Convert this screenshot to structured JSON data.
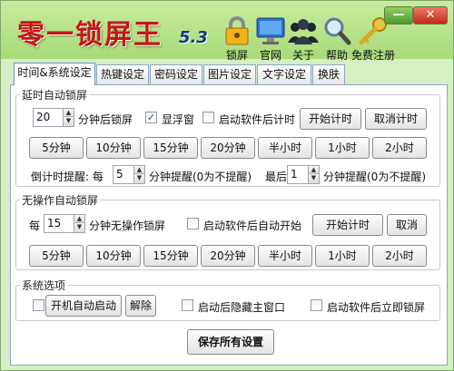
{
  "app": {
    "title": "零一锁屏王",
    "version": "5.3"
  },
  "toolbar": {
    "lock_label": "锁屏",
    "site_label": "官网",
    "about_label": "关于",
    "help_label": "帮助",
    "register_label": "免费注册"
  },
  "window_controls": {
    "minimize": "—",
    "close": "✕"
  },
  "tabs": [
    {
      "label": "时间&系统设定",
      "active": true
    },
    {
      "label": "热键设定"
    },
    {
      "label": "密码设定"
    },
    {
      "label": "图片设定"
    },
    {
      "label": "文字设定"
    },
    {
      "label": "换肤"
    }
  ],
  "delay_lock": {
    "title": "延时自动锁屏",
    "minutes_value": "20",
    "minutes_suffix": "分钟后锁屏",
    "float_window_label": "显浮窗",
    "float_window_checked": true,
    "start_on_launch_label": "启动软件后计时",
    "start_on_launch_checked": false,
    "start_button": "开始计时",
    "cancel_button": "取消计时",
    "presets": [
      "5分钟",
      "10分钟",
      "15分钟",
      "20分钟",
      "半小时",
      "1小时",
      "2小时"
    ],
    "reminder_prefix": "倒计时提醒: 每",
    "reminder_every_value": "5",
    "reminder_every_suffix": "分钟提醒(0为不提醒)",
    "reminder_last_prefix": "最后",
    "reminder_last_value": "1",
    "reminder_last_suffix": "分钟提醒(0为不提醒)"
  },
  "idle_lock": {
    "title": "无操作自动锁屏",
    "prefix": "每",
    "minutes_value": "15",
    "minutes_suffix": "分钟无操作锁屏",
    "start_on_launch_label": "启动软件后自动开始",
    "start_on_launch_checked": false,
    "start_button": "开始计时",
    "cancel_button": "取消",
    "presets": [
      "5分钟",
      "10分钟",
      "15分钟",
      "20分钟",
      "半小时",
      "1小时",
      "2小时"
    ]
  },
  "system": {
    "title": "系统选项",
    "autostart_button": "开机自动启动",
    "remove_button": "解除",
    "hide_main_label": "启动后隐藏主窗口",
    "lock_immediately_label": "启动软件后立即锁屏"
  },
  "save_button": "保存所有设置",
  "colors": {
    "header_green": "#a9da78",
    "title_red": "#c21a10",
    "version_blue": "#123a7c"
  }
}
